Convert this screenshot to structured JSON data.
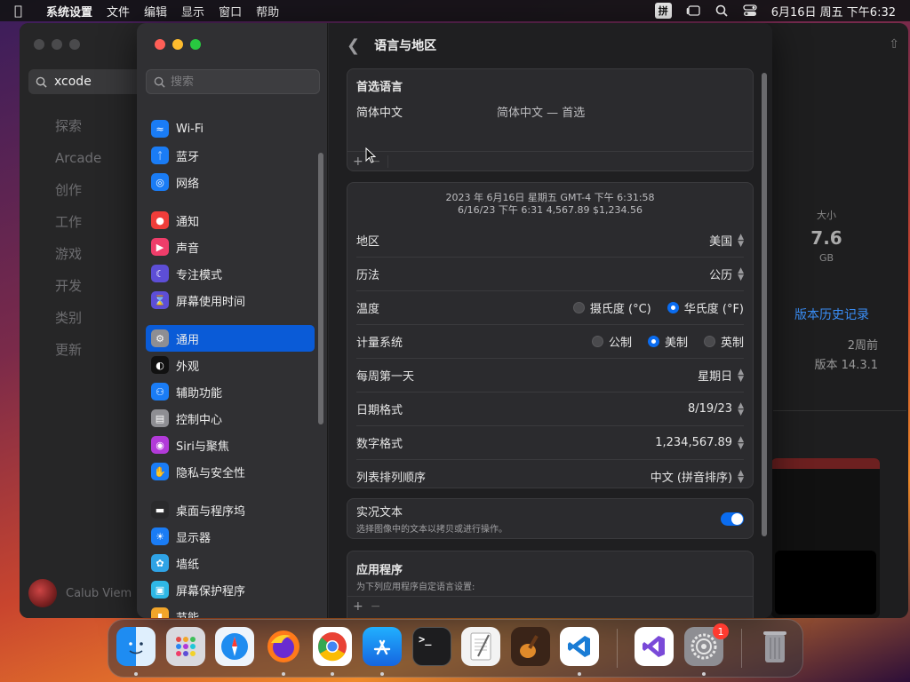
{
  "menubar": {
    "app_name": "系统设置",
    "items": [
      "文件",
      "编辑",
      "显示",
      "窗口",
      "帮助"
    ],
    "input_method": "拼",
    "datetime": "6月16日 周五  下午6:32"
  },
  "appstore": {
    "search_value": "xcode",
    "nav": [
      "探索",
      "Arcade",
      "创作",
      "工作",
      "游戏",
      "开发",
      "类别",
      "更新"
    ],
    "user_name": "Calub Viem",
    "size_label": "大小",
    "size_value": "7.6",
    "size_unit": "GB",
    "version_history": "版本历史记录",
    "updated_ago": "2周前",
    "version": "版本 14.3.1"
  },
  "sidebar": {
    "search_placeholder": "搜索",
    "groups": [
      [
        {
          "label": "Wi-Fi",
          "icon": "wifi-icon",
          "color": "#1a7cf5"
        },
        {
          "label": "蓝牙",
          "icon": "bluetooth-icon",
          "color": "#1a7cf5"
        },
        {
          "label": "网络",
          "icon": "globe-icon",
          "color": "#1a7cf5"
        }
      ],
      [
        {
          "label": "通知",
          "icon": "bell-icon",
          "color": "#ef3d3a"
        },
        {
          "label": "声音",
          "icon": "speaker-icon",
          "color": "#ef3d6a"
        },
        {
          "label": "专注模式",
          "icon": "moon-icon",
          "color": "#5d4ed6"
        },
        {
          "label": "屏幕使用时间",
          "icon": "hourglass-icon",
          "color": "#5d4ed6"
        }
      ],
      [
        {
          "label": "通用",
          "icon": "gear-icon",
          "color": "#8e8e93",
          "selected": true
        },
        {
          "label": "外观",
          "icon": "appearance-icon",
          "color": "#111111"
        },
        {
          "label": "辅助功能",
          "icon": "accessibility-icon",
          "color": "#1a7cf5"
        },
        {
          "label": "控制中心",
          "icon": "control-center-icon",
          "color": "#8e8e93"
        },
        {
          "label": "Siri与聚焦",
          "icon": "siri-icon",
          "color": "#b23ad9"
        },
        {
          "label": "隐私与安全性",
          "icon": "hand-icon",
          "color": "#1a7cf5"
        }
      ],
      [
        {
          "label": "桌面与程序坞",
          "icon": "dock-icon",
          "color": "#2a2a2c"
        },
        {
          "label": "显示器",
          "icon": "sun-icon",
          "color": "#1a7cf5"
        },
        {
          "label": "墙纸",
          "icon": "flower-icon",
          "color": "#2fa3e6"
        },
        {
          "label": "屏幕保护程序",
          "icon": "screensaver-icon",
          "color": "#2fb8e6"
        },
        {
          "label": "节能",
          "icon": "battery-icon",
          "color": "#f2a52a"
        }
      ]
    ]
  },
  "main": {
    "title": "语言与地区",
    "preferred": {
      "header": "首选语言",
      "language": "简体中文",
      "language_detail": "简体中文 — 首选"
    },
    "preview": {
      "line1": "2023 年 6月16日 星期五 GMT-4 下午 6:31:58",
      "line2": "6/16/23 下午 6:31     4,567.89     $1,234.56"
    },
    "rows": {
      "region": {
        "label": "地区",
        "value": "美国"
      },
      "calendar": {
        "label": "历法",
        "value": "公历"
      },
      "temperature": {
        "label": "温度",
        "options": [
          "摄氏度 (°C)",
          "华氏度 (°F)"
        ],
        "selected": 1
      },
      "measurement": {
        "label": "计量系统",
        "options": [
          "公制",
          "美制",
          "英制"
        ],
        "selected": 1
      },
      "first_day": {
        "label": "每周第一天",
        "value": "星期日"
      },
      "date_format": {
        "label": "日期格式",
        "value": "8/19/23"
      },
      "number_format": {
        "label": "数字格式",
        "value": "1,234,567.89"
      },
      "list_sort": {
        "label": "列表排列顺序",
        "value": "中文 (拼音排序)"
      }
    },
    "live_text": {
      "title": "实况文本",
      "subtitle": "选择图像中的文本以拷贝或进行操作。",
      "enabled": true
    },
    "apps": {
      "title": "应用程序",
      "subtitle": "为下列应用程序自定语言设置:"
    }
  },
  "dock": {
    "apps": [
      "finder-icon",
      "launchpad-icon",
      "safari-icon",
      "firefox-icon",
      "chrome-icon",
      "appstore-icon",
      "terminal-icon",
      "textedit-icon",
      "garageband-icon",
      "vscode-icon",
      "visualstudio-icon",
      "system-settings-icon",
      "trash-icon"
    ],
    "settings_badge": "1"
  }
}
